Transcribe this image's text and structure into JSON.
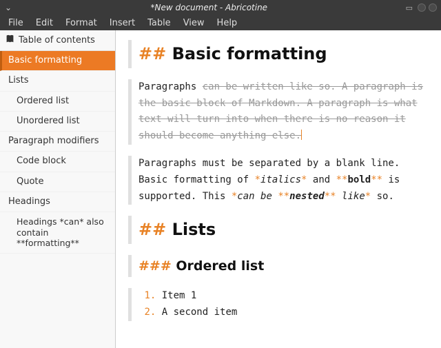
{
  "window": {
    "title": "*New document - Abricotine"
  },
  "menubar": {
    "file": "File",
    "edit": "Edit",
    "format": "Format",
    "insert": "Insert",
    "table": "Table",
    "view": "View",
    "help": "Help"
  },
  "sidebar": {
    "header": "Table of contents",
    "items": [
      {
        "label": "Basic formatting",
        "level": 2,
        "active": true
      },
      {
        "label": "Lists",
        "level": 2,
        "active": false
      },
      {
        "label": "Ordered list",
        "level": 3,
        "active": false
      },
      {
        "label": "Unordered list",
        "level": 3,
        "active": false
      },
      {
        "label": "Paragraph modifiers",
        "level": 2,
        "active": false
      },
      {
        "label": "Code block",
        "level": 3,
        "active": false
      },
      {
        "label": "Quote",
        "level": 3,
        "active": false
      },
      {
        "label": "Headings",
        "level": 2,
        "active": false
      },
      {
        "label": "Headings *can* also contain **formatting**",
        "level": 4,
        "active": false
      }
    ]
  },
  "editor": {
    "h2_prefix": "## ",
    "h3_prefix": "### ",
    "heading1": "Basic formatting",
    "para1_prefix": "Paragraphs ",
    "para1_struck": "can be written like so. A paragraph is the basic block of Markdown. A paragraph is what text will turn into when there is no reason it should become anything else.",
    "para2_a": "Paragraphs must be separated by a blank line. Basic formatting of ",
    "star1": "*",
    "italics_word": "italics",
    "para2_b": " and ",
    "star2": "**",
    "bold_word": "bold",
    "para2_c": " is supported. This ",
    "nested_a": "can be ",
    "nested_bold": "nested",
    "nested_b": " like",
    "para2_d": " so.",
    "heading2": "Lists",
    "heading3": "Ordered list",
    "ol1_num": "1.",
    "ol1_text": " Item 1",
    "ol2_num": "2.",
    "ol2_text": " A second item"
  }
}
